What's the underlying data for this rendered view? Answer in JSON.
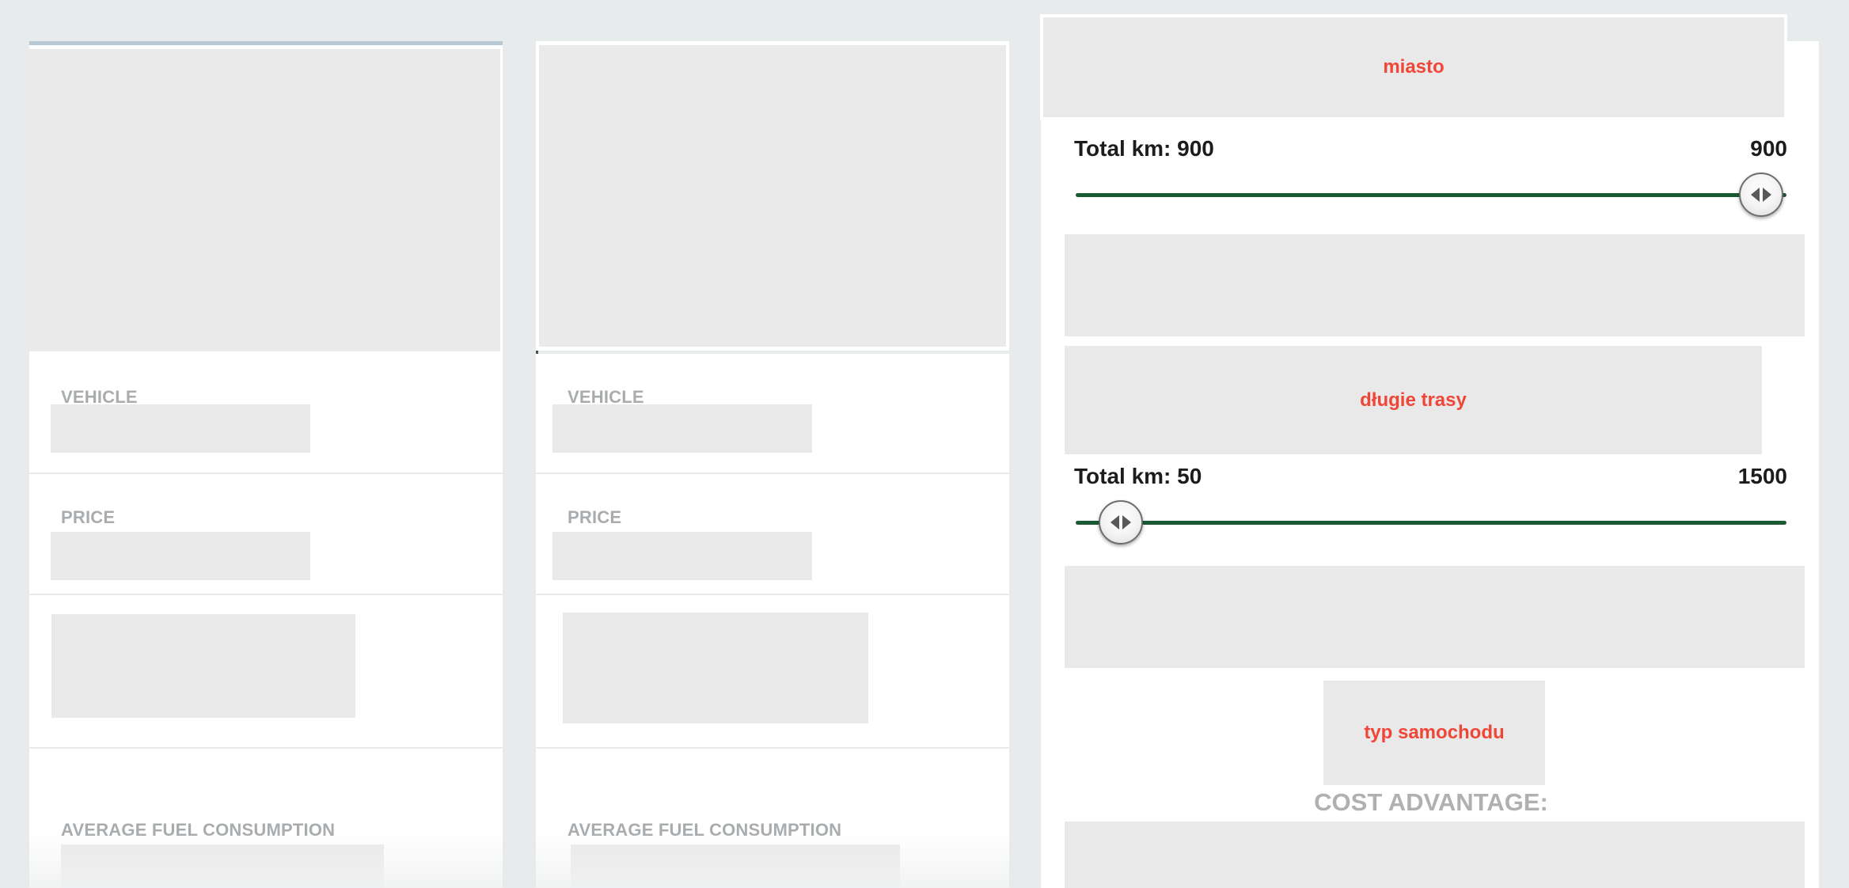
{
  "vehicle_columns": [
    {
      "vehicle_label": "VEHICLE",
      "price_label": "PRICE",
      "fuel_label": "AVERAGE FUEL CONSUMPTION"
    },
    {
      "vehicle_label": "VEHICLE",
      "price_label": "PRICE",
      "fuel_label": "AVERAGE FUEL CONSUMPTION"
    }
  ],
  "panel": {
    "city_tag": "miasto",
    "city_slider": {
      "label": "Total km: 900",
      "max_label": "900",
      "value": 900,
      "max": 900
    },
    "long_routes_tag": "długie trasy",
    "routes_slider": {
      "label": "Total km: 50",
      "max_label": "1500",
      "value": 50,
      "max": 1500
    },
    "car_type_tag": "typ samochodu",
    "cost_advantage_title": "COST ADVANTAGE:"
  },
  "colors": {
    "page_bg": "#e8ebec",
    "placeholder": "#e9e9e9",
    "tag_text": "#ef4637",
    "label_gray": "#a9acae",
    "slider_track": "#1a5a33"
  },
  "icons": {
    "slider_knob": "left-right-arrows-icon"
  }
}
